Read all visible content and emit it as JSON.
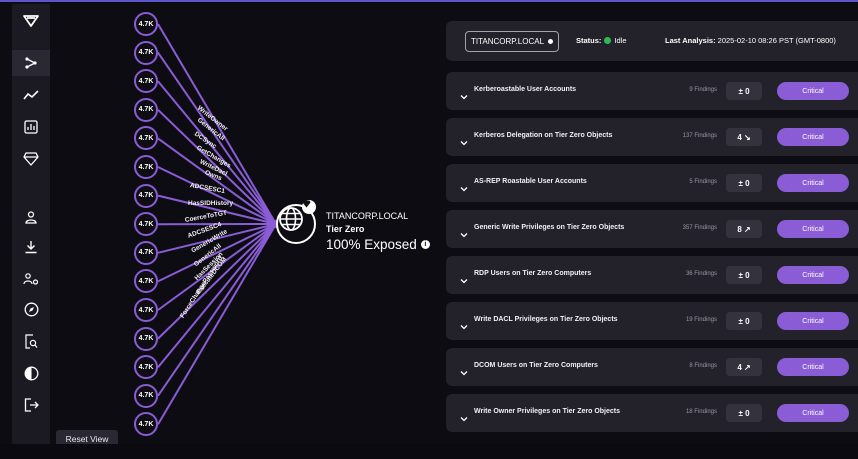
{
  "sidebar": {
    "items": [
      {
        "icon": "logo-icon"
      },
      {
        "icon": "attack-path-icon",
        "active": true
      },
      {
        "icon": "trend-icon"
      },
      {
        "icon": "report-icon"
      },
      {
        "icon": "gem-icon"
      },
      {
        "icon": "user-icon"
      },
      {
        "icon": "download-icon"
      },
      {
        "icon": "users-gear-icon"
      },
      {
        "icon": "compass-icon"
      },
      {
        "icon": "search-doc-icon"
      },
      {
        "icon": "contrast-icon"
      },
      {
        "icon": "logout-icon"
      }
    ]
  },
  "graph": {
    "node_label": "4.7K",
    "node_count": 15,
    "edge_labels": [
      "WriteOwner",
      "GenericAll",
      "DCSync",
      "GetChanges",
      "WriteDacl",
      "Owns",
      "ADCSESC1",
      "HasSIDHistory",
      "CoerceToTGT",
      "ADCSESC4",
      "GenericWrite",
      "GenericAll",
      "HasSession",
      "ExecuteDCOM",
      "ForceChangePassword"
    ],
    "target": {
      "name": "TITANCORP.LOCAL",
      "tier": "Tier Zero",
      "exposure": "100% Exposed"
    },
    "reset_label": "Reset View"
  },
  "header": {
    "domain": "TITANCORP.LOCAL",
    "status_label": "Status:",
    "status_value": "Idle",
    "status_color": "#2fb956",
    "last_label": "Last Analysis:",
    "last_value": "2025-02-10 08:26 PST (GMT-0800)"
  },
  "findings": [
    {
      "title": "Kerberoastable User Accounts",
      "count": "9 Findings",
      "delta": "± 0",
      "severity": "Critical"
    },
    {
      "title": "Kerberos Delegation on Tier Zero Objects",
      "count": "137 Findings",
      "delta": "4 ↘",
      "severity": "Critical"
    },
    {
      "title": "AS-REP Roastable User Accounts",
      "count": "5 Findings",
      "delta": "± 0",
      "severity": "Critical"
    },
    {
      "title": "Generic Write Privileges on Tier Zero Objects",
      "count": "357 Findings",
      "delta": "8 ↗",
      "severity": "Critical"
    },
    {
      "title": "RDP Users on Tier Zero Computers",
      "count": "36 Findings",
      "delta": "± 0",
      "severity": "Critical"
    },
    {
      "title": "Write DACL Privileges on Tier Zero Objects",
      "count": "19 Findings",
      "delta": "± 0",
      "severity": "Critical"
    },
    {
      "title": "DCOM Users on Tier Zero Computers",
      "count": "8 Findings",
      "delta": "4 ↗",
      "severity": "Critical"
    },
    {
      "title": "Write Owner Privileges on Tier Zero Objects",
      "count": "18 Findings",
      "delta": "± 0",
      "severity": "Critical"
    }
  ],
  "colors": {
    "accent": "#8a5cd6",
    "panel": "#232129",
    "background": "#0d0c12"
  }
}
